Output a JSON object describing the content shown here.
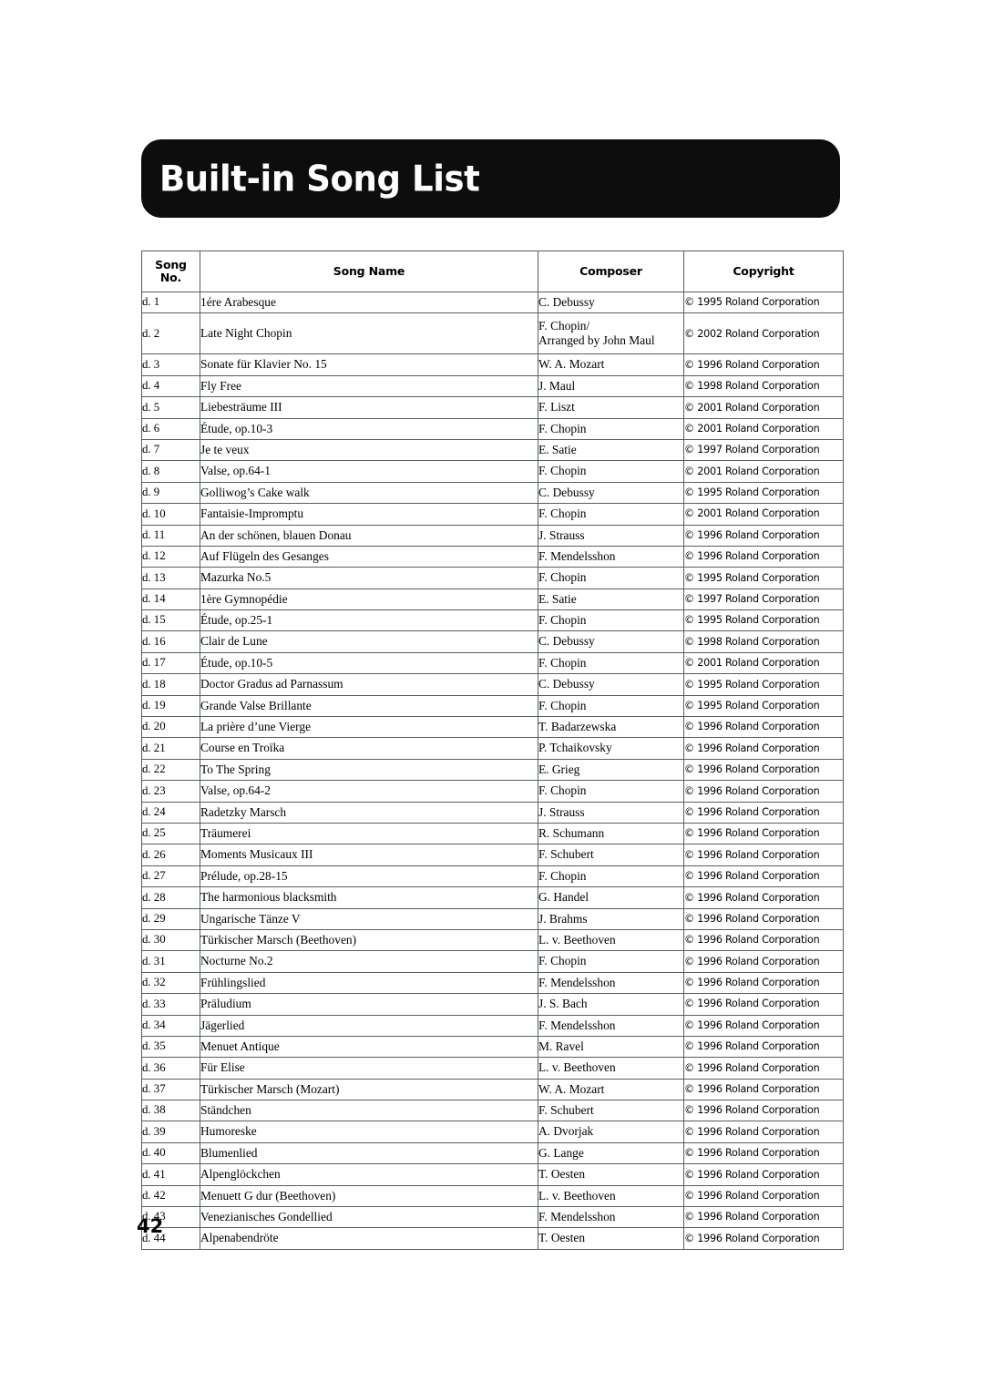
{
  "page": {
    "title": "Built-in Song List",
    "page_number": "42"
  },
  "table": {
    "headers": {
      "song_no_line1": "Song",
      "song_no_line2": "No.",
      "song_name": "Song Name",
      "composer": "Composer",
      "copyright": "Copyright"
    },
    "rows": [
      {
        "no": "d. 1",
        "name": "1ére Arabesque",
        "composer": "C. Debussy",
        "composer2": "",
        "copyright": "© 1995 Roland Corporation"
      },
      {
        "no": "d. 2",
        "name": "Late Night Chopin",
        "composer": "F. Chopin/",
        "composer2": "Arranged by John Maul",
        "copyright": "© 2002 Roland Corporation"
      },
      {
        "no": "d. 3",
        "name": "Sonate für Klavier No. 15",
        "composer": "W. A. Mozart",
        "composer2": "",
        "copyright": "© 1996 Roland Corporation"
      },
      {
        "no": "d. 4",
        "name": "Fly Free",
        "composer": "J. Maul",
        "composer2": "",
        "copyright": "© 1998 Roland Corporation"
      },
      {
        "no": "d. 5",
        "name": "Liebesträume III",
        "composer": "F. Liszt",
        "composer2": "",
        "copyright": "© 2001 Roland Corporation"
      },
      {
        "no": "d. 6",
        "name": "Étude, op.10-3",
        "composer": "F. Chopin",
        "composer2": "",
        "copyright": "© 2001 Roland Corporation"
      },
      {
        "no": "d. 7",
        "name": "Je te veux",
        "composer": "E. Satie",
        "composer2": "",
        "copyright": "© 1997 Roland Corporation"
      },
      {
        "no": "d. 8",
        "name": "Valse, op.64-1",
        "composer": "F. Chopin",
        "composer2": "",
        "copyright": "© 2001 Roland Corporation"
      },
      {
        "no": "d. 9",
        "name": "Golliwog’s Cake walk",
        "composer": "C. Debussy",
        "composer2": "",
        "copyright": "© 1995 Roland Corporation"
      },
      {
        "no": "d. 10",
        "name": "Fantaisie-Impromptu",
        "composer": "F. Chopin",
        "composer2": "",
        "copyright": "© 2001 Roland Corporation"
      },
      {
        "no": "d. 11",
        "name": "An der schönen, blauen Donau",
        "composer": "J. Strauss",
        "composer2": "",
        "copyright": "© 1996 Roland Corporation"
      },
      {
        "no": "d. 12",
        "name": "Auf Flügeln des Gesanges",
        "composer": "F. Mendelsshon",
        "composer2": "",
        "copyright": "© 1996 Roland Corporation"
      },
      {
        "no": "d. 13",
        "name": "Mazurka No.5",
        "composer": "F. Chopin",
        "composer2": "",
        "copyright": "© 1995 Roland Corporation"
      },
      {
        "no": "d. 14",
        "name": "1ère Gymnopédie",
        "composer": "E. Satie",
        "composer2": "",
        "copyright": "© 1997 Roland Corporation"
      },
      {
        "no": "d. 15",
        "name": "Étude, op.25-1",
        "composer": "F. Chopin",
        "composer2": "",
        "copyright": "© 1995 Roland Corporation"
      },
      {
        "no": "d. 16",
        "name": "Clair de Lune",
        "composer": "C. Debussy",
        "composer2": "",
        "copyright": "© 1998 Roland Corporation"
      },
      {
        "no": "d. 17",
        "name": "Étude, op.10-5",
        "composer": "F. Chopin",
        "composer2": "",
        "copyright": "© 2001 Roland Corporation"
      },
      {
        "no": "d. 18",
        "name": "Doctor Gradus ad Parnassum",
        "composer": "C. Debussy",
        "composer2": "",
        "copyright": "© 1995 Roland Corporation"
      },
      {
        "no": "d. 19",
        "name": "Grande Valse Brillante",
        "composer": "F. Chopin",
        "composer2": "",
        "copyright": "© 1995 Roland Corporation"
      },
      {
        "no": "d. 20",
        "name": "La prière d’une Vierge",
        "composer": "T. Badarzewska",
        "composer2": "",
        "copyright": "© 1996 Roland Corporation"
      },
      {
        "no": "d. 21",
        "name": "Course en Troïka",
        "composer": "P. Tchaikovsky",
        "composer2": "",
        "copyright": "© 1996 Roland Corporation"
      },
      {
        "no": "d. 22",
        "name": "To The Spring",
        "composer": "E. Grieg",
        "composer2": "",
        "copyright": "© 1996 Roland Corporation"
      },
      {
        "no": "d. 23",
        "name": "Valse, op.64-2",
        "composer": "F. Chopin",
        "composer2": "",
        "copyright": "© 1996 Roland Corporation"
      },
      {
        "no": "d. 24",
        "name": "Radetzky Marsch",
        "composer": "J. Strauss",
        "composer2": "",
        "copyright": "© 1996 Roland Corporation"
      },
      {
        "no": "d. 25",
        "name": "Träumerei",
        "composer": "R. Schumann",
        "composer2": "",
        "copyright": "© 1996 Roland Corporation"
      },
      {
        "no": "d. 26",
        "name": "Moments Musicaux III",
        "composer": "F. Schubert",
        "composer2": "",
        "copyright": "© 1996 Roland Corporation"
      },
      {
        "no": "d. 27",
        "name": "Prélude, op.28-15",
        "composer": "F. Chopin",
        "composer2": "",
        "copyright": "© 1996 Roland Corporation"
      },
      {
        "no": "d. 28",
        "name": "The harmonious blacksmith",
        "composer": "G. Handel",
        "composer2": "",
        "copyright": "© 1996 Roland Corporation"
      },
      {
        "no": "d. 29",
        "name": "Ungarische Tänze V",
        "composer": "J. Brahms",
        "composer2": "",
        "copyright": "© 1996 Roland Corporation"
      },
      {
        "no": "d. 30",
        "name": "Türkischer Marsch (Beethoven)",
        "composer": "L. v. Beethoven",
        "composer2": "",
        "copyright": "© 1996 Roland Corporation"
      },
      {
        "no": "d. 31",
        "name": "Nocturne No.2",
        "composer": "F. Chopin",
        "composer2": "",
        "copyright": "© 1996 Roland Corporation"
      },
      {
        "no": "d. 32",
        "name": "Frühlingslied",
        "composer": "F. Mendelsshon",
        "composer2": "",
        "copyright": "© 1996 Roland Corporation"
      },
      {
        "no": "d. 33",
        "name": "Präludium",
        "composer": "J. S. Bach",
        "composer2": "",
        "copyright": "© 1996 Roland Corporation"
      },
      {
        "no": "d. 34",
        "name": "Jägerlied",
        "composer": "F. Mendelsshon",
        "composer2": "",
        "copyright": "© 1996 Roland Corporation"
      },
      {
        "no": "d. 35",
        "name": "Menuet Antique",
        "composer": "M. Ravel",
        "composer2": "",
        "copyright": "© 1996 Roland Corporation"
      },
      {
        "no": "d. 36",
        "name": "Für Elise",
        "composer": "L. v. Beethoven",
        "composer2": "",
        "copyright": "© 1996 Roland Corporation"
      },
      {
        "no": "d. 37",
        "name": "Türkischer Marsch (Mozart)",
        "composer": "W. A. Mozart",
        "composer2": "",
        "copyright": "© 1996 Roland Corporation"
      },
      {
        "no": "d. 38",
        "name": "Ständchen",
        "composer": "F. Schubert",
        "composer2": "",
        "copyright": "© 1996 Roland Corporation"
      },
      {
        "no": "d. 39",
        "name": "Humoreske",
        "composer": "A. Dvorjak",
        "composer2": "",
        "copyright": "© 1996 Roland Corporation"
      },
      {
        "no": "d. 40",
        "name": "Blumenlied",
        "composer": "G. Lange",
        "composer2": "",
        "copyright": "© 1996 Roland Corporation"
      },
      {
        "no": "d. 41",
        "name": "Alpenglöckchen",
        "composer": "T. Oesten",
        "composer2": "",
        "copyright": "© 1996 Roland Corporation"
      },
      {
        "no": "d. 42",
        "name": "Menuett G dur (Beethoven)",
        "composer": "L. v. Beethoven",
        "composer2": "",
        "copyright": "© 1996 Roland Corporation"
      },
      {
        "no": "d. 43",
        "name": "Venezianisches Gondellied",
        "composer": "F. Mendelsshon",
        "composer2": "",
        "copyright": "© 1996 Roland Corporation"
      },
      {
        "no": "d. 44",
        "name": "Alpenabendröte",
        "composer": "T. Oesten",
        "composer2": "",
        "copyright": "© 1996 Roland Corporation"
      }
    ]
  }
}
